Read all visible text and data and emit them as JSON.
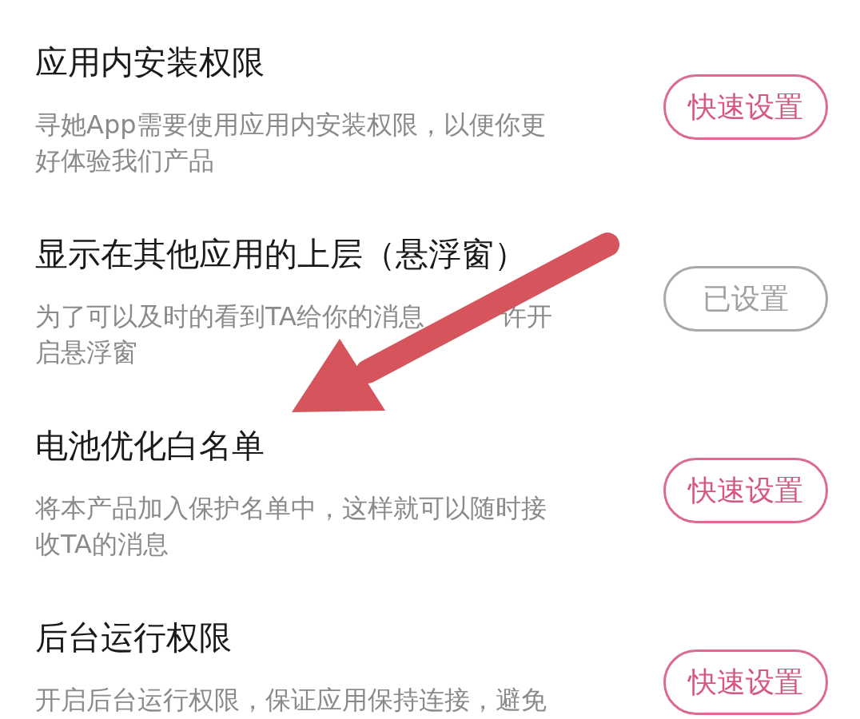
{
  "items": [
    {
      "title": "应用内安装权限",
      "description": [
        "寻她App需要使用应用内安装权限，以便你更好体验我们产品"
      ],
      "button": {
        "label": "快速设置",
        "done": false
      }
    },
    {
      "title": "显示在其他应用的上层（悬浮窗）",
      "description": [
        "为了可以及时的看到TA给你的消息",
        "许开启悬浮窗"
      ],
      "button": {
        "label": "已设置",
        "done": true
      }
    },
    {
      "title": "电池优化白名单",
      "description": [
        "将本产品加入保护名单中，这样就可以随时接收TA的消息"
      ],
      "button": {
        "label": "快速设置",
        "done": false
      }
    },
    {
      "title": "后台运行权限",
      "description": [
        "开启后台运行权限，保证应用保持连接，避免"
      ],
      "button": {
        "label": "快速设置",
        "done": false
      }
    }
  ]
}
